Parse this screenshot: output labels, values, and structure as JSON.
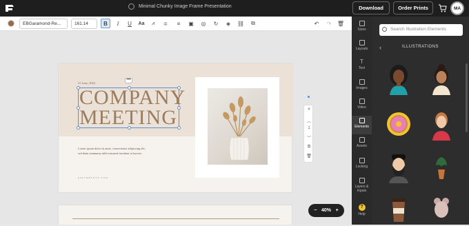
{
  "topbar": {
    "title": "Minimal Chunky Image Frame Presentation",
    "download_label": "Download",
    "order_prints_label": "Order Prints",
    "avatar_initials": "MA"
  },
  "toolbar": {
    "font_family": "EBGaramond-Re...",
    "font_size": "161.14",
    "case_label": "Aa"
  },
  "slide": {
    "date": "21 June, 2022",
    "headline_line1": "COMPANY",
    "headline_line2": "MEETING",
    "body": "Lorem ipsum dolor sit amet, consectetuer adipiscing elit, sed diam nonummy nibh euismod tincidunt ut laoreet.",
    "website": "yourwebsite.com",
    "more_label": "•••"
  },
  "page_tools": {
    "page_number": "1"
  },
  "zoom": {
    "value": "40%",
    "minus": "−",
    "plus": "+"
  },
  "rail": {
    "items": [
      {
        "label": "Sizes"
      },
      {
        "label": "Layouts"
      },
      {
        "label": "Text"
      },
      {
        "label": "Images"
      },
      {
        "label": "Video"
      },
      {
        "label": "Elements"
      },
      {
        "label": "Assets"
      },
      {
        "label": "Locking"
      },
      {
        "label": "Layers & Inputs"
      },
      {
        "label": "Help"
      }
    ]
  },
  "panel": {
    "search_placeholder": "Search Illustration Elements",
    "section_title": "ILLUSTRATIONS"
  },
  "colors": {
    "accent": "#5a8fd6",
    "headline": "#9a7d5f",
    "dark_bg": "#1e1e1e"
  }
}
